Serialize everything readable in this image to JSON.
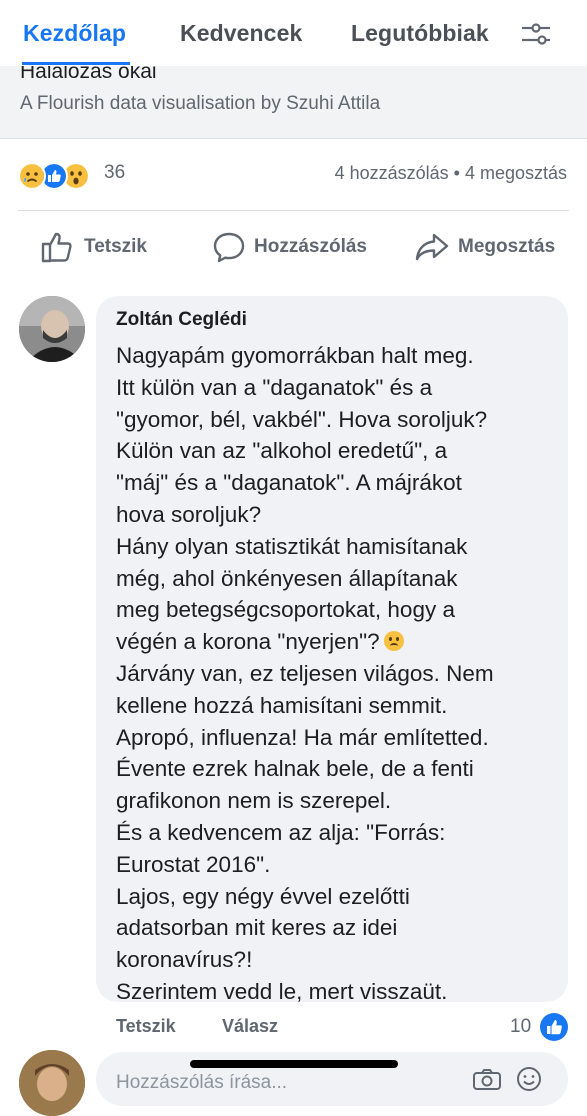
{
  "tabs": [
    {
      "label": "Kezdőlap",
      "active": true
    },
    {
      "label": "Kedvencek",
      "active": false
    },
    {
      "label": "Legutóbbiak",
      "active": false
    }
  ],
  "filter_icon": "filter-sliders-icon",
  "link_preview": {
    "title": "Halálozás okai",
    "subtitle": "A Flourish data visualisation by Szuhi Attila"
  },
  "reactions": {
    "icons": [
      "sad-reaction-icon",
      "like-reaction-icon",
      "wow-reaction-icon"
    ],
    "count": "36",
    "stats": "4 hozzászólás • 4 megosztás"
  },
  "actions": {
    "like": "Tetszik",
    "comment": "Hozzászólás",
    "share": "Megosztás"
  },
  "comment": {
    "author": "Zoltán Ceglédi",
    "lines": [
      "Nagyapám gyomorrákban halt meg.",
      "Itt külön van a \"daganatok\" és a",
      "\"gyomor, bél, vakbél\". Hova soroljuk?",
      "Külön van az \"alkohol eredetű\", a",
      "\"máj\" és a \"daganatok\". A májrákot",
      "hova soroljuk?",
      "Hány olyan statisztikát hamisítanak",
      "még, ahol önkényesen állapítanak",
      "meg betegségcsoportokat, hogy a",
      "végén a korona \"nyerjen\"?",
      "Járvány van, ez teljesen világos. Nem",
      "kellene hozzá hamisítani semmit.",
      "Apropó, influenza! Ha már említetted.",
      "Évente ezrek halnak bele, de a fenti",
      "grafikonon nem is szerepel.",
      "És a kedvencem az alja: \"Forrás:",
      "Eurostat 2016\".",
      "Lajos, egy négy évvel ezelőtti",
      "adatsorban mit keres az idei",
      "koronavírus?!",
      "Szerintem vedd le, mert visszaüt."
    ],
    "like_label": "Tetszik",
    "reply_label": "Válasz",
    "like_count": "10"
  },
  "reply_input": {
    "placeholder": "Hozzászólás írása..."
  },
  "colors": {
    "brand": "#1877f2",
    "bubble": "#f0f2f5",
    "muted_text": "#606770"
  }
}
